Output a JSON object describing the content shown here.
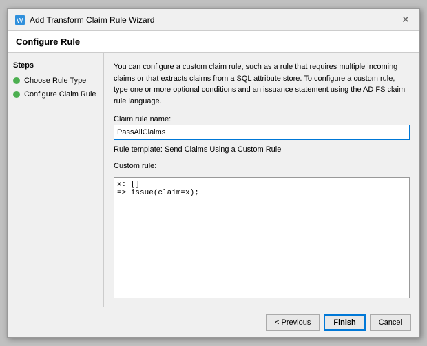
{
  "dialog": {
    "title": "Add Transform Claim Rule Wizard",
    "section_header": "Configure Rule"
  },
  "steps": {
    "label": "Steps",
    "items": [
      {
        "label": "Choose Rule Type",
        "done": true
      },
      {
        "label": "Configure Claim Rule",
        "done": true
      }
    ]
  },
  "main": {
    "description": "You can configure a custom claim rule, such as a rule that requires multiple incoming claims or that extracts claims from a SQL attribute store. To configure a custom rule, type one or more optional conditions and an issuance statement using the AD FS claim rule language.",
    "claim_rule_name_label": "Claim rule name:",
    "claim_rule_name_value": "PassAllClaims",
    "rule_template_text": "Rule template: Send Claims Using a Custom Rule",
    "custom_rule_label": "Custom rule:",
    "custom_rule_value": "x: []\n=> issue(claim=x);"
  },
  "footer": {
    "previous_label": "< Previous",
    "finish_label": "Finish",
    "cancel_label": "Cancel"
  },
  "icons": {
    "close": "✕",
    "wizard": "⚙"
  }
}
